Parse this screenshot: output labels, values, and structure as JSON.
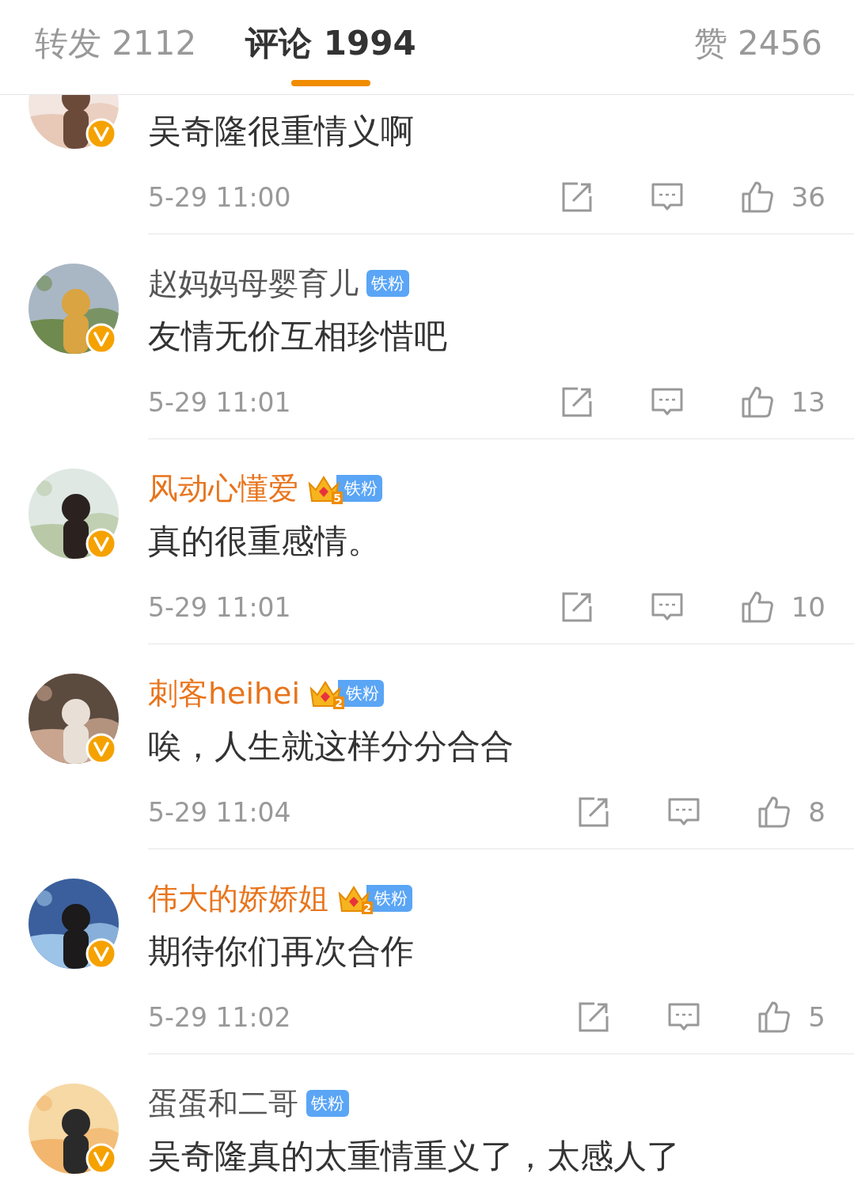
{
  "tabs": [
    {
      "label": "转发 2112",
      "selected": false
    },
    {
      "label": "评论 1994",
      "selected": true
    },
    {
      "label": "赞 2456",
      "selected": false
    }
  ],
  "comments": [
    {
      "verified": true,
      "text": "吴奇隆很重情义啊",
      "time": "5-29 11:00",
      "likes": "36"
    },
    {
      "name": "赵妈妈母婴育儿",
      "vip": false,
      "verified": true,
      "badge": {
        "kind": "plain",
        "label": "铁粉"
      },
      "text": "友情无价互相珍惜吧",
      "time": "5-29 11:01",
      "likes": "13"
    },
    {
      "name": "风动心懂爱",
      "vip": true,
      "verified": true,
      "badge": {
        "kind": "crown",
        "level": "5",
        "label": "铁粉"
      },
      "text": "真的很重感情。",
      "time": "5-29 11:01",
      "likes": "10"
    },
    {
      "name": "刺客heihei",
      "vip": true,
      "verified": true,
      "badge": {
        "kind": "crown",
        "level": "2",
        "label": "铁粉"
      },
      "text": "唉，人生就这样分分合合",
      "time": "5-29 11:04",
      "likes": "8"
    },
    {
      "name": "伟大的娇娇姐",
      "vip": true,
      "verified": true,
      "badge": {
        "kind": "crown",
        "level": "2",
        "label": "铁粉"
      },
      "text": "期待你们再次合作",
      "time": "5-29 11:02",
      "likes": "5"
    },
    {
      "name": "蛋蛋和二哥",
      "vip": false,
      "verified": true,
      "badge": {
        "kind": "plain",
        "label": "铁粉"
      },
      "text": "吴奇隆真的太重情重义了，太感人了"
    }
  ]
}
